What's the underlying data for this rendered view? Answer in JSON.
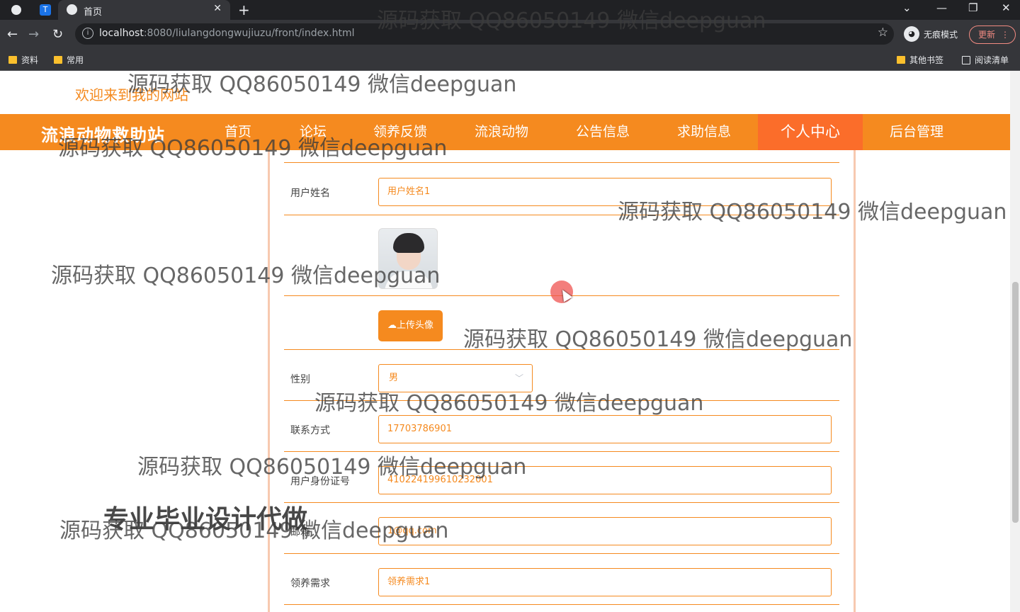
{
  "browser": {
    "tab_title": "首页",
    "url_host": "localhost",
    "url_rest": ":8080/liulangdongwujiuzu/front/index.html",
    "incognito_label": "无痕模式",
    "update_label": "更新",
    "bookmarks": [
      "资料",
      "常用"
    ],
    "bookmarks_right": [
      "其他书签",
      "阅读清单"
    ]
  },
  "site": {
    "welcome": "欢迎来到我的网站",
    "brand": "流浪动物救助站",
    "nav": [
      "首页",
      "论坛",
      "领养反馈",
      "流浪动物",
      "公告信息",
      "求助信息",
      "个人中心",
      "后台管理"
    ],
    "active_nav": "个人中心"
  },
  "form": {
    "name_label": "用户姓名",
    "name_value": "用户姓名1",
    "upload_label": "上传头像",
    "gender_label": "性别",
    "gender_value": "男",
    "phone_label": "联系方式",
    "phone_value": "17703786901",
    "idcard_label": "用户身份证号",
    "idcard_value": "410224199610232001",
    "email_label": "邮箱",
    "email_value": "1@qq.com",
    "need_label": "领养需求",
    "need_value": "领养需求1"
  },
  "overlay": {
    "watermark": "源码获取 QQ86050149 微信deepguan",
    "stamp": "专业毕业设计代做"
  },
  "colors": {
    "accent": "#f58a1f",
    "nav_active": "#fb6d2a"
  }
}
